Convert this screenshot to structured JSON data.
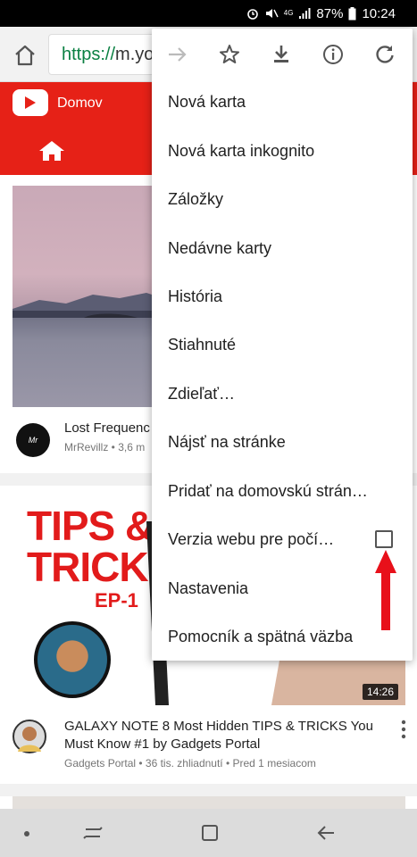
{
  "status_bar": {
    "network": "4G",
    "battery": "87%",
    "time": "10:24"
  },
  "browser": {
    "url_scheme": "https://",
    "url_rest": "m.yo"
  },
  "youtube": {
    "header_title": "Domov",
    "brand_color": "#e62117"
  },
  "videos": [
    {
      "title": "Lost Frequenc",
      "meta": "MrRevillz • 3,6 m",
      "channel_avatar_text": "Mr Revillz"
    },
    {
      "title_line1": "GALAXY NOTE 8 Most Hidden TIPS & TRICKS You",
      "title_line2": "Must Know #1 by Gadgets Portal",
      "meta": "Gadgets Portal • 36 tis. zhliadnutí • Pred 1 mesiacom",
      "duration": "14:26",
      "thumb_line1": "TIPS &",
      "thumb_line2": "TRICKS",
      "thumb_ep": "EP-1"
    }
  ],
  "menu": {
    "icons": [
      "forward-icon",
      "bookmark-star-icon",
      "download-icon",
      "info-icon",
      "refresh-icon"
    ],
    "items": [
      "Nová karta",
      "Nová karta inkognito",
      "Záložky",
      "Nedávne karty",
      "História",
      "Stiahnuté",
      "Zdieľať…",
      "Nájsť na stránke",
      "Pridať na domovskú strán…",
      "Verzia webu pre počí…",
      "Nastavenia",
      "Pomocník a spätná väzba"
    ],
    "desktop_site_checked": false
  },
  "annotation_color": "#e8101a"
}
